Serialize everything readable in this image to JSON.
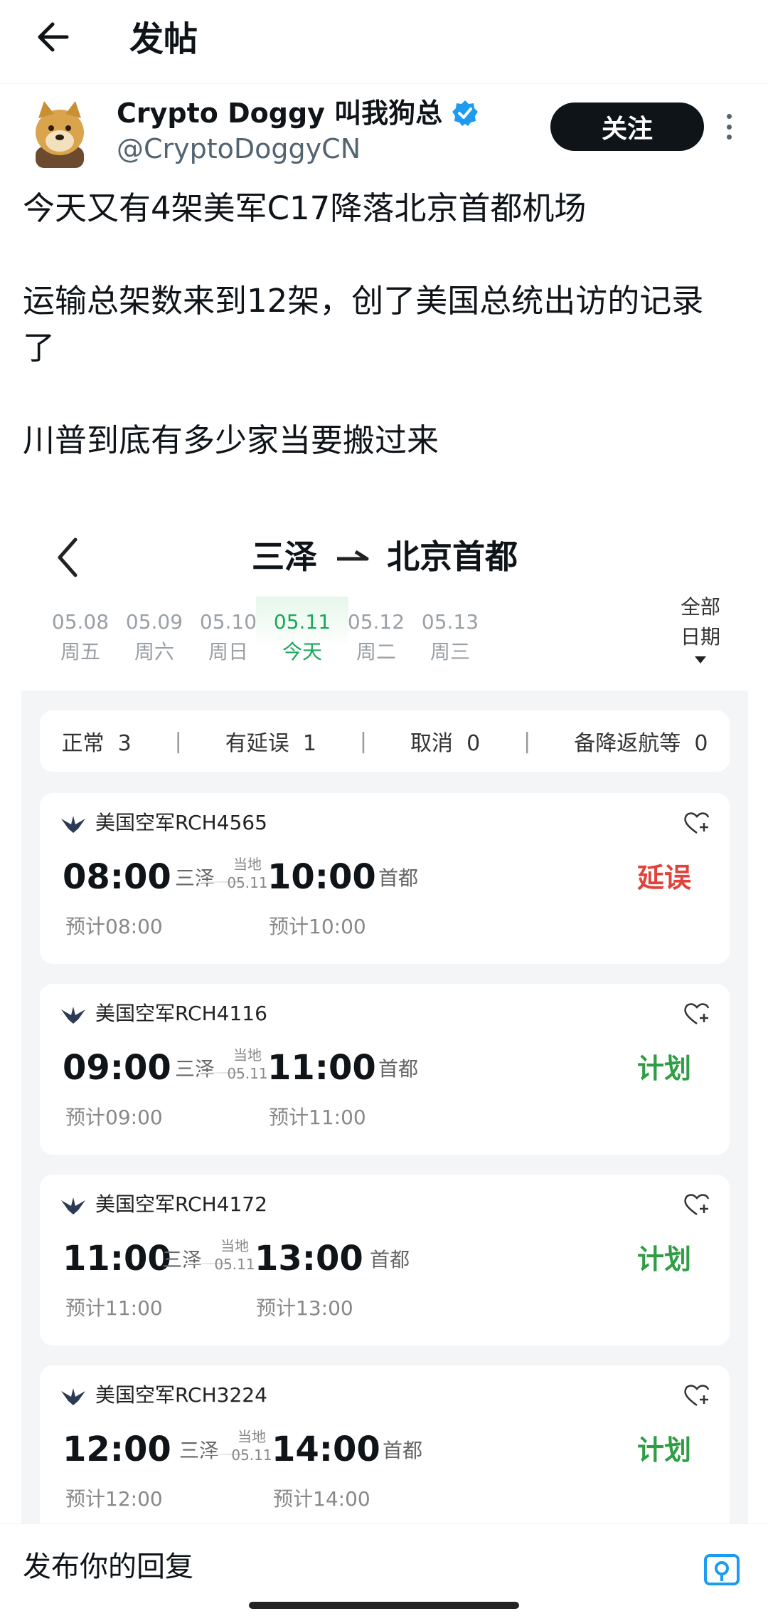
{
  "header": {
    "title": "发帖"
  },
  "author": {
    "name": "Crypto Doggy 叫我狗总",
    "handle": "@CryptoDoggyCN",
    "follow_label": "关注"
  },
  "post": {
    "lines": [
      "今天又有4架美军C17降落北京首都机场",
      "运输总架数来到12架，创了美国总统出访的记录",
      "了",
      "川普到底有多少家当要搬过来"
    ]
  },
  "embed": {
    "origin": "三泽",
    "destination": "北京首都",
    "dates": [
      {
        "date": "05.08",
        "weekday": "周五"
      },
      {
        "date": "05.09",
        "weekday": "周六"
      },
      {
        "date": "05.10",
        "weekday": "周日"
      },
      {
        "date": "05.11",
        "weekday": "今天"
      },
      {
        "date": "05.12",
        "weekday": "周二"
      },
      {
        "date": "05.13",
        "weekday": "周三"
      }
    ],
    "active_date_index": 3,
    "all_dates_line1": "全部",
    "all_dates_line2": "日期",
    "summary": {
      "normal_label": "正常",
      "normal_count": "3",
      "delayed_label": "有延误",
      "delayed_count": "1",
      "cancelled_label": "取消",
      "cancelled_count": "0",
      "diverted_label": "备降返航等",
      "diverted_count": "0",
      "separator": "|"
    },
    "local_label": "当地",
    "flights": [
      {
        "airline": "美国空军RCH4565",
        "dep_time": "08:00",
        "dep_city": "三泽",
        "arr_date": "05.11",
        "arr_time": "10:00",
        "arr_city": "首都",
        "dep_est": "预计08:00",
        "arr_est": "预计10:00",
        "status": "延误",
        "status_color": "#e0433b"
      },
      {
        "airline": "美国空军RCH4116",
        "dep_time": "09:00",
        "dep_city": "三泽",
        "arr_date": "05.11",
        "arr_time": "11:00",
        "arr_city": "首都",
        "dep_est": "预计09:00",
        "arr_est": "预计11:00",
        "status": "计划",
        "status_color": "#2e9d44"
      },
      {
        "airline": "美国空军RCH4172",
        "dep_time": "11:00",
        "dep_city": "三泽",
        "arr_date": "05.11",
        "arr_time": "13:00",
        "arr_city": "首都",
        "dep_est": "预计11:00",
        "arr_est": "预计13:00",
        "status": "计划",
        "status_color": "#2e9d44"
      },
      {
        "airline": "美国空军RCH3224",
        "dep_time": "12:00",
        "dep_city": "三泽",
        "arr_date": "05.11",
        "arr_time": "14:00",
        "arr_city": "首都",
        "dep_est": "预计12:00",
        "arr_est": "预计14:00",
        "status": "计划",
        "status_color": "#2e9d44"
      }
    ]
  },
  "reply": {
    "placeholder": "发布你的回复"
  },
  "colors": {
    "accent": "#1d9bf0",
    "verified": "#1d9bf0",
    "active_date": "#1aa85a",
    "delayed": "#e0433b",
    "scheduled": "#2e9d44"
  },
  "icons": {
    "back": "arrow-left-icon",
    "verified": "verified-badge-icon",
    "more": "more-vertical-icon",
    "favorite": "heart-plus-icon",
    "airline": "usaf-wings-icon",
    "media": "image-icon"
  }
}
